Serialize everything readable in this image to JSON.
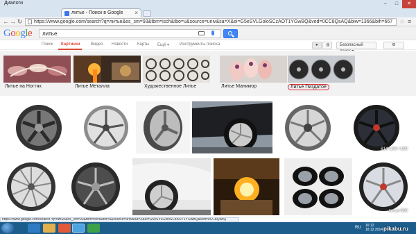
{
  "titlebar": {
    "app_label": "Диалоги",
    "minimize": "–",
    "maximize": "□",
    "close": "✕"
  },
  "tab": {
    "title": "литье - Поиск в Google",
    "close": "×"
  },
  "address": {
    "url": "https://www.google.com/search?q=литье&es_sm=93&tbm=isch&tbo=u&source=univ&sa=X&ei=G5eSVLGoloSCzAOT1YGwBQ&ved=0CC8QsAQ&biw=1366&bih=667"
  },
  "google": {
    "logo_letters": [
      {
        "ch": "G",
        "color": "#4285f4"
      },
      {
        "ch": "o",
        "color": "#ea4335"
      },
      {
        "ch": "o",
        "color": "#fbbc05"
      },
      {
        "ch": "g",
        "color": "#4285f4"
      },
      {
        "ch": "l",
        "color": "#34a853"
      },
      {
        "ch": "e",
        "color": "#ea4335"
      }
    ],
    "query": "литье",
    "nav": [
      "Поиск",
      "Картинки",
      "Видео",
      "Новости",
      "Карты",
      "Ещё ▾",
      "Инструменты поиска"
    ],
    "active_nav": "Картинки",
    "safe_search": "Безопасный поиск ▾"
  },
  "related": [
    {
      "label": "Литье на Ногтях",
      "icon": "nails-thumb"
    },
    {
      "label": "Литье Металла",
      "icon": "metal-pour-thumb"
    },
    {
      "label": "Художественное Литье",
      "icon": "ornament-thumb"
    },
    {
      "label": "Литье Маникюр",
      "icon": "manicure-thumb"
    },
    {
      "label": "Литье Пиздатое",
      "icon": "wheels-thumb",
      "highlighted": true
    }
  ],
  "results": [
    {
      "name": "wheel-dark-5spoke"
    },
    {
      "name": "wheel-silver-spoke"
    },
    {
      "name": "wheel-dark-angle"
    },
    {
      "name": "car-wheel-black"
    },
    {
      "name": "wheel-silver-multi"
    },
    {
      "name": "wheel-black-red",
      "overlay": "614×100  ×100"
    },
    {
      "name": "wheel-chrome-10spoke"
    },
    {
      "name": "wheel-black-deep"
    },
    {
      "name": "car-wheel-white"
    },
    {
      "name": "foundry-pour"
    },
    {
      "name": "wheel-set-black"
    },
    {
      "name": "wheel-silver-ice",
      "overlay": "литье 600"
    }
  ],
  "status_url": "https://www.google.com/search?q=литье&es_sm=93&tbm=isch&tbo=u&source=univ&sa=X&ei=G5eSVLGoloSCzAOT1YGwBQ&ved=0CC8QsAQ",
  "taskbar": {
    "lang": "RU",
    "time": "16:12",
    "date": "18.12.2014"
  },
  "watermark": "pikabu.ru"
}
